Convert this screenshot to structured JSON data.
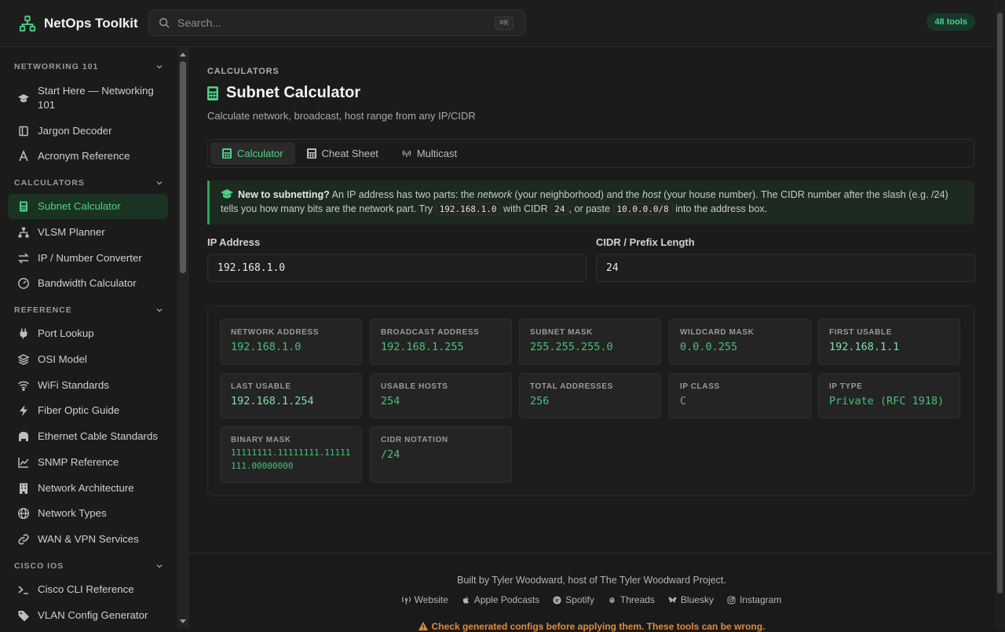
{
  "header": {
    "brand": "NetOps Toolkit",
    "search_placeholder": "Search...",
    "shortcut": "⌘K",
    "tools_badge": "48 tools"
  },
  "sidebar": {
    "sections": [
      {
        "title": "NETWORKING 101",
        "items": [
          "Start Here — Networking 101",
          "Jargon Decoder",
          "Acronym Reference"
        ]
      },
      {
        "title": "CALCULATORS",
        "items": [
          "Subnet Calculator",
          "VLSM Planner",
          "IP / Number Converter",
          "Bandwidth Calculator"
        ]
      },
      {
        "title": "REFERENCE",
        "items": [
          "Port Lookup",
          "OSI Model",
          "WiFi Standards",
          "Fiber Optic Guide",
          "Ethernet Cable Standards",
          "SNMP Reference",
          "Network Architecture",
          "Network Types",
          "WAN & VPN Services"
        ]
      },
      {
        "title": "CISCO IOS",
        "items": [
          "Cisco CLI Reference",
          "VLAN Config Generator"
        ]
      }
    ],
    "active_item": "Subnet Calculator"
  },
  "main": {
    "eyebrow": "CALCULATORS",
    "title": "Subnet Calculator",
    "subtitle": "Calculate network, broadcast, host range from any IP/CIDR",
    "tabs": [
      "Calculator",
      "Cheat Sheet",
      "Multicast"
    ],
    "active_tab": "Calculator",
    "callout": {
      "lead": "New to subnetting?",
      "t1": " An IP address has two parts: the ",
      "em1": "network",
      "t2": " (your neighborhood) and the ",
      "em2": "host",
      "t3": " (your house number). The CIDR number after the slash (e.g. /24) tells you how many bits are the network part. Try ",
      "code1": "192.168.1.0",
      "t4": " with CIDR ",
      "code2": "24",
      "t5": ", or paste ",
      "code3": "10.0.0.0/8",
      "t6": " into the address box."
    },
    "ip_label": "IP Address",
    "ip_value": "192.168.1.0",
    "cidr_label": "CIDR / Prefix Length",
    "cidr_value": "24",
    "results": [
      {
        "k": "NETWORK ADDRESS",
        "v": "192.168.1.0"
      },
      {
        "k": "BROADCAST ADDRESS",
        "v": "192.168.1.255"
      },
      {
        "k": "SUBNET MASK",
        "v": "255.255.255.0"
      },
      {
        "k": "WILDCARD MASK",
        "v": "0.0.0.255"
      },
      {
        "k": "FIRST USABLE",
        "v": "192.168.1.1"
      },
      {
        "k": "LAST USABLE",
        "v": "192.168.1.254"
      },
      {
        "k": "USABLE HOSTS",
        "v": "254"
      },
      {
        "k": "TOTAL ADDRESSES",
        "v": "256"
      },
      {
        "k": "IP CLASS",
        "v": "C"
      },
      {
        "k": "IP TYPE",
        "v": "Private (RFC 1918)"
      },
      {
        "k": "BINARY MASK",
        "v": "11111111.11111111.11111111.00000000"
      },
      {
        "k": "CIDR NOTATION",
        "v": "/24"
      }
    ]
  },
  "footer": {
    "credit": "Built by Tyler Woodward, host of The Tyler Woodward Project.",
    "links": [
      "Website",
      "Apple Podcasts",
      "Spotify",
      "Threads",
      "Bluesky",
      "Instagram"
    ],
    "warning": "Check generated configs before applying them. These tools can be wrong."
  },
  "colors": {
    "accent": "#4ed184",
    "accent_bg": "#1b3323",
    "warning": "#e38b3c",
    "background": "#1b1b1b"
  }
}
